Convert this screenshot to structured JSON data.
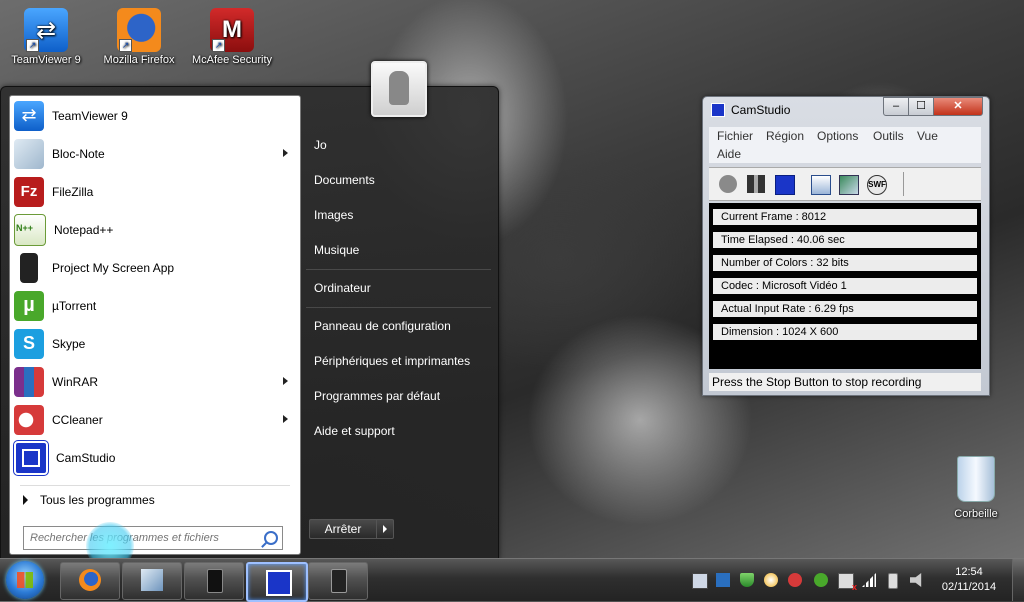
{
  "desktop": {
    "icons": [
      {
        "label": "TeamViewer 9",
        "icon": "teamviewer-icon"
      },
      {
        "label": "Mozilla Firefox",
        "icon": "firefox-icon"
      },
      {
        "label": "McAfee Security",
        "icon": "mcafee-icon"
      }
    ],
    "recycle_bin": {
      "label": "Corbeille",
      "icon": "recycle-bin-icon"
    }
  },
  "start_menu": {
    "programs": [
      {
        "label": "TeamViewer 9",
        "icon": "teamviewer-icon",
        "submenu": false
      },
      {
        "label": "Bloc-Note",
        "icon": "notepad-icon",
        "submenu": true
      },
      {
        "label": "FileZilla",
        "icon": "filezilla-icon",
        "submenu": false
      },
      {
        "label": "Notepad++",
        "icon": "notepadplusplus-icon",
        "submenu": false
      },
      {
        "label": "Project My Screen App",
        "icon": "phone-icon",
        "submenu": false
      },
      {
        "label": "µTorrent",
        "icon": "utorrent-icon",
        "submenu": false
      },
      {
        "label": "Skype",
        "icon": "skype-icon",
        "submenu": false
      },
      {
        "label": "WinRAR",
        "icon": "winrar-icon",
        "submenu": true
      },
      {
        "label": "CCleaner",
        "icon": "ccleaner-icon",
        "submenu": true
      },
      {
        "label": "CamStudio",
        "icon": "camstudio-icon",
        "submenu": false
      }
    ],
    "all_programs": "Tous les programmes",
    "search_placeholder": "Rechercher les programmes et fichiers",
    "right_links": [
      "Jo",
      "Documents",
      "Images",
      "Musique",
      "Ordinateur",
      "Panneau de configuration",
      "Périphériques et imprimantes",
      "Programmes par défaut",
      "Aide et support"
    ],
    "shutdown_label": "Arrêter"
  },
  "camstudio": {
    "title": "CamStudio",
    "menu": [
      "Fichier",
      "Région",
      "Options",
      "Outils",
      "Vue",
      "Aide"
    ],
    "toolbar": [
      "record-icon",
      "pause-icon",
      "stop-icon",
      "region-icon",
      "annotation-icon",
      "swf-icon"
    ],
    "swf_text": "SWF",
    "stats": [
      "Current Frame : 8012",
      "Time Elapsed : 40.06 sec",
      "Number of Colors : 32 bits",
      "Codec : Microsoft Vidéo 1",
      "Actual Input Rate : 6.29 fps",
      "Dimension : 1024 X 600"
    ],
    "status": "Press the Stop Button to stop recording",
    "window_buttons": {
      "minimize": "–",
      "maximize": "☐",
      "close": "✕"
    }
  },
  "taskbar": {
    "buttons": [
      "firefox-icon",
      "notepad-icon",
      "project-my-screen-icon",
      "camstudio-icon",
      "phone-icon"
    ],
    "clock": {
      "time": "12:54",
      "date": "02/11/2014"
    }
  }
}
